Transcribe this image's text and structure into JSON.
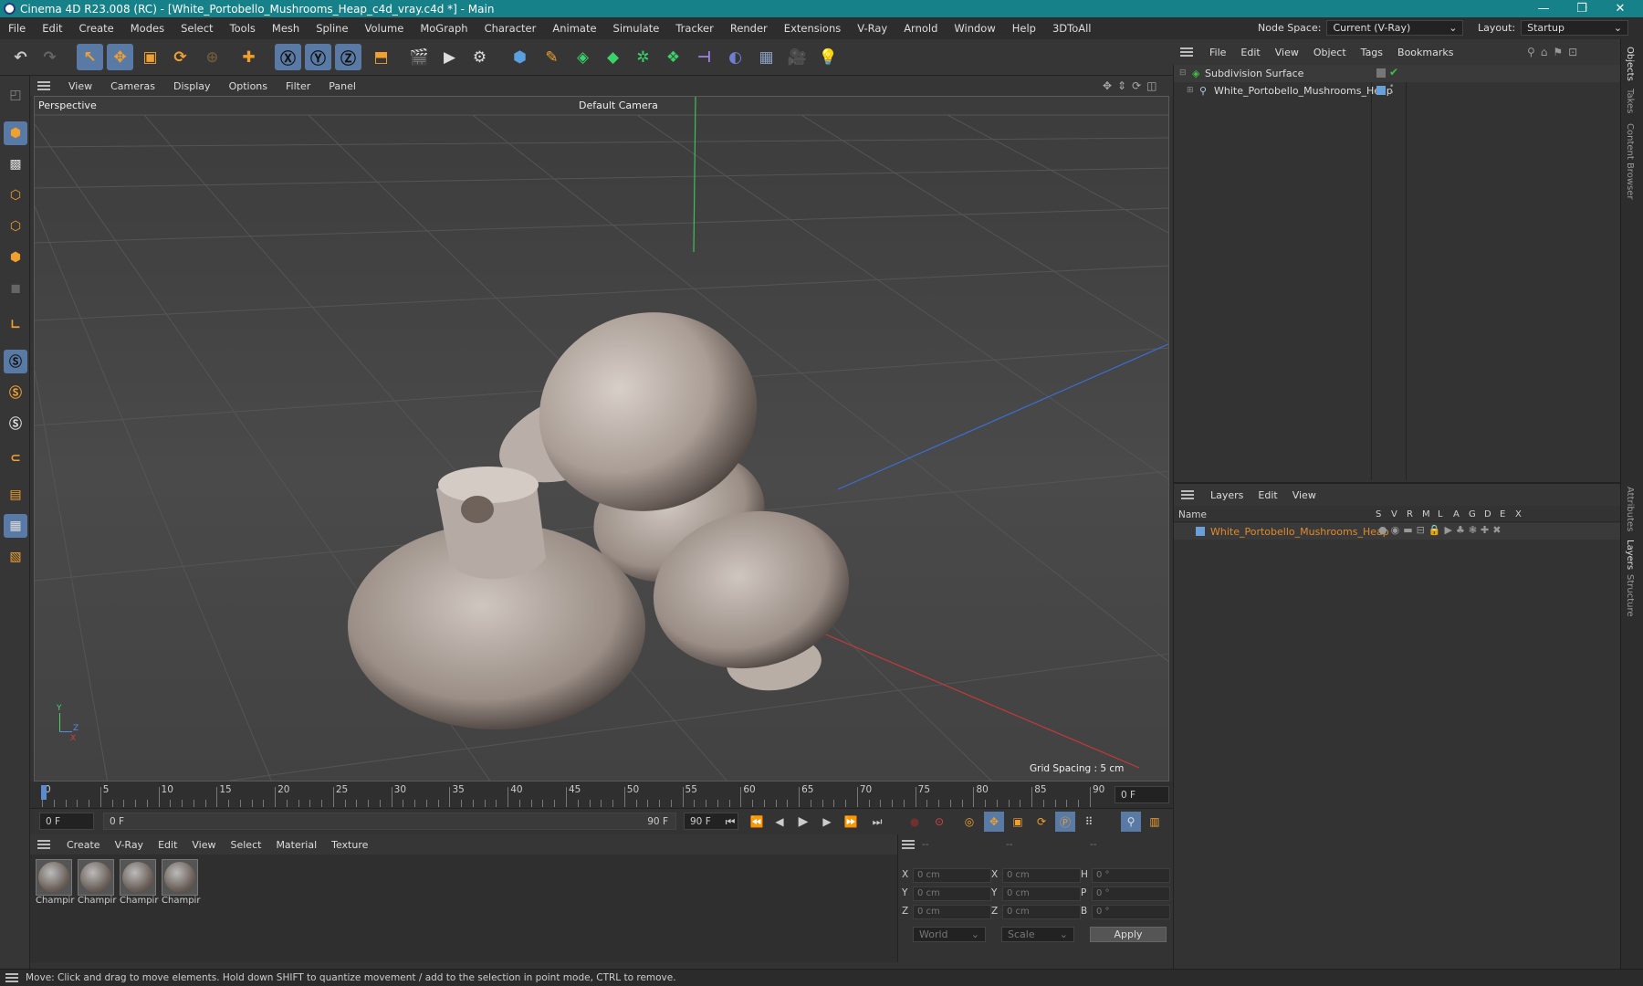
{
  "window": {
    "title": "Cinema 4D R23.008 (RC) - [White_Portobello_Mushrooms_Heap_c4d_vray.c4d *] - Main",
    "minimize": "—",
    "maximize": "❐",
    "close": "✕"
  },
  "menubar": {
    "items": [
      "File",
      "Edit",
      "Create",
      "Modes",
      "Select",
      "Tools",
      "Mesh",
      "Spline",
      "Volume",
      "MoGraph",
      "Character",
      "Animate",
      "Simulate",
      "Tracker",
      "Render",
      "Extensions",
      "V-Ray",
      "Arnold",
      "Window",
      "Help",
      "3DToAll"
    ],
    "node_space_label": "Node Space:",
    "node_space_value": "Current (V-Ray)",
    "layout_label": "Layout:",
    "layout_value": "Startup"
  },
  "viewport": {
    "menu": [
      "View",
      "Cameras",
      "Display",
      "Options",
      "Filter",
      "Panel"
    ],
    "name": "Perspective",
    "camera": "Default Camera",
    "grid_spacing": "Grid Spacing : 5 cm",
    "axis_y": "Y",
    "axis_z": "Z",
    "axis_x": "X"
  },
  "timeline": {
    "ticks": [
      "0",
      "5",
      "10",
      "15",
      "20",
      "25",
      "30",
      "35",
      "40",
      "45",
      "50",
      "55",
      "60",
      "65",
      "70",
      "75",
      "80",
      "85",
      "90"
    ],
    "current_frame": "0 F",
    "start_field": "0 F",
    "range_start": "0 F",
    "range_end": "90 F",
    "end_field": "90 F"
  },
  "materials": {
    "menu": [
      "Create",
      "V-Ray",
      "Edit",
      "View",
      "Select",
      "Material",
      "Texture"
    ],
    "items": [
      "Champir",
      "Champir",
      "Champir",
      "Champir"
    ]
  },
  "coords": {
    "header": [
      "--",
      "--",
      "--"
    ],
    "rows": [
      {
        "a": "X",
        "v1": "0 cm",
        "b": "X",
        "v2": "0 cm",
        "c": "H",
        "v3": "0 °"
      },
      {
        "a": "Y",
        "v1": "0 cm",
        "b": "Y",
        "v2": "0 cm",
        "c": "P",
        "v3": "0 °"
      },
      {
        "a": "Z",
        "v1": "0 cm",
        "b": "Z",
        "v2": "0 cm",
        "c": "B",
        "v3": "0 °"
      }
    ],
    "space": "World",
    "mode": "Scale",
    "apply": "Apply"
  },
  "objects": {
    "menu": [
      "File",
      "Edit",
      "View",
      "Object",
      "Tags",
      "Bookmarks"
    ],
    "tree": [
      {
        "name": "Subdivision Surface",
        "color": "#3fbf3f"
      },
      {
        "name": "White_Portobello_Mushrooms_Heap",
        "color": "#6aa0d8"
      }
    ]
  },
  "layers": {
    "menu": [
      "Layers",
      "Edit",
      "View"
    ],
    "col_name": "Name",
    "flags": [
      "S",
      "V",
      "R",
      "M",
      "L",
      "A",
      "G",
      "D",
      "E",
      "X"
    ],
    "rows": [
      {
        "name": "White_Portobello_Mushrooms_Heap",
        "color": "#e08a2c"
      }
    ]
  },
  "right_tabs": [
    "Objects",
    "Takes",
    "Content Browser",
    "Attributes",
    "Layers",
    "Structure"
  ],
  "status": "Move: Click and drag to move elements. Hold down SHIFT to quantize movement / add to the selection in point mode, CTRL to remove."
}
